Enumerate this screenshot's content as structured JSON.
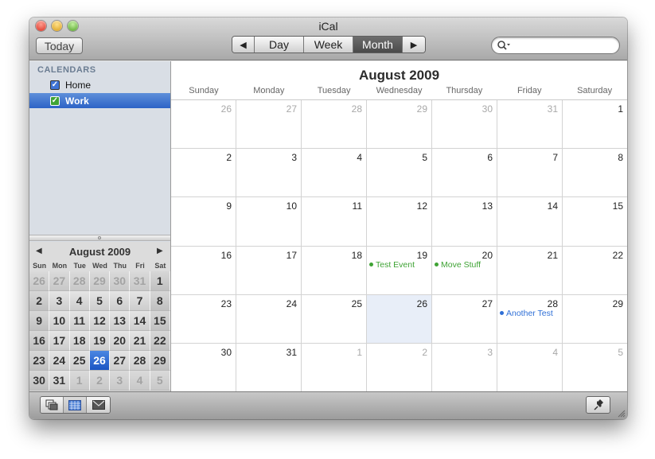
{
  "window": {
    "title": "iCal"
  },
  "toolbar": {
    "today_label": "Today",
    "prev_symbol": "◀",
    "next_symbol": "▶",
    "view_day": "Day",
    "view_week": "Week",
    "view_month": "Month",
    "active_view": "Month",
    "search_placeholder": ""
  },
  "sidebar": {
    "header": "CALENDARS",
    "calendars": [
      {
        "label": "Home",
        "checked": true,
        "color": "#3f74d6",
        "selected": false
      },
      {
        "label": "Work",
        "checked": true,
        "color": "#3fa335",
        "selected": true
      }
    ]
  },
  "mini_calendar": {
    "title": "August 2009",
    "prev_symbol": "◀",
    "next_symbol": "▶",
    "weekdays": [
      "Sun",
      "Mon",
      "Tue",
      "Wed",
      "Thu",
      "Fri",
      "Sat"
    ],
    "weeks": [
      [
        "26",
        "27",
        "28",
        "29",
        "30",
        "31",
        "1"
      ],
      [
        "2",
        "3",
        "4",
        "5",
        "6",
        "7",
        "8"
      ],
      [
        "9",
        "10",
        "11",
        "12",
        "13",
        "14",
        "15"
      ],
      [
        "16",
        "17",
        "18",
        "19",
        "20",
        "21",
        "22"
      ],
      [
        "23",
        "24",
        "25",
        "26",
        "27",
        "28",
        "29"
      ],
      [
        "30",
        "31",
        "1",
        "2",
        "3",
        "4",
        "5"
      ]
    ],
    "today": "26"
  },
  "month_view": {
    "title": "August 2009",
    "weekdays": [
      "Sunday",
      "Monday",
      "Tuesday",
      "Wednesday",
      "Thursday",
      "Friday",
      "Saturday"
    ],
    "weeks": [
      [
        "26",
        "27",
        "28",
        "29",
        "30",
        "31",
        "1"
      ],
      [
        "2",
        "3",
        "4",
        "5",
        "6",
        "7",
        "8"
      ],
      [
        "9",
        "10",
        "11",
        "12",
        "13",
        "14",
        "15"
      ],
      [
        "16",
        "17",
        "18",
        "19",
        "20",
        "21",
        "22"
      ],
      [
        "23",
        "24",
        "25",
        "26",
        "27",
        "28",
        "29"
      ],
      [
        "30",
        "31",
        "1",
        "2",
        "3",
        "4",
        "5"
      ]
    ],
    "selected_day": "26",
    "events": {
      "test_event": {
        "label": "Test Event",
        "day": "19",
        "color": "#3fa335"
      },
      "move_stuff": {
        "label": "Move Stuff",
        "day": "20",
        "color": "#3fa335"
      },
      "another_test": {
        "label": "Another Test",
        "day": "28",
        "color": "#2f6fd6"
      }
    }
  },
  "bottom_bar": {
    "buttons": [
      "calendars-list-icon",
      "mini-month-icon",
      "mail-icon"
    ],
    "active_button": "mini-month-icon",
    "pin_icon": "pin-icon"
  }
}
